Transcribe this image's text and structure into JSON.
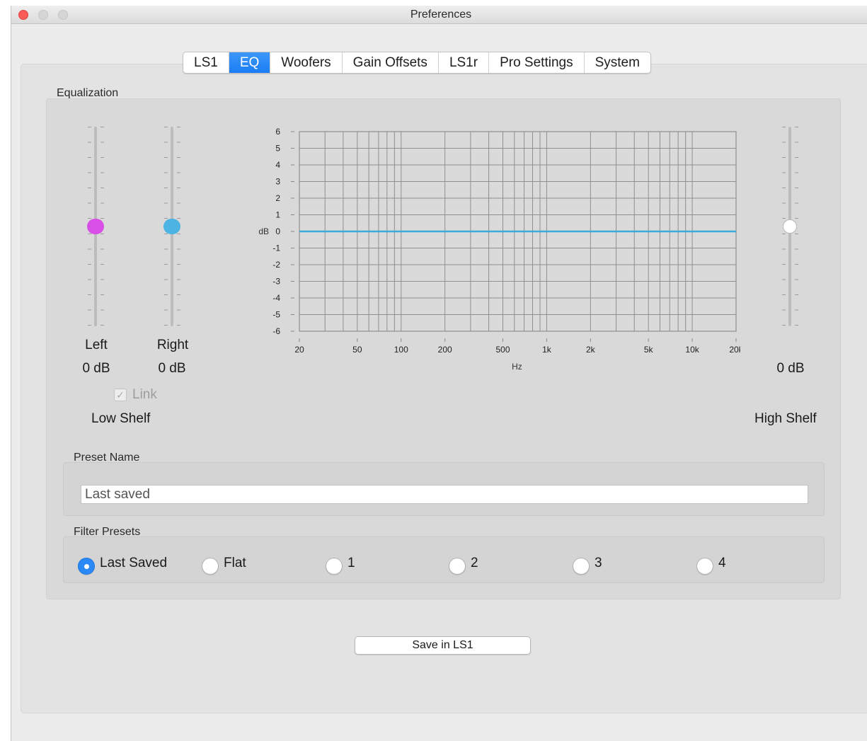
{
  "window": {
    "title": "Preferences"
  },
  "tabs": [
    {
      "label": "LS1",
      "active": false
    },
    {
      "label": "EQ",
      "active": true
    },
    {
      "label": "Woofers",
      "active": false
    },
    {
      "label": "Gain Offsets",
      "active": false
    },
    {
      "label": "LS1r",
      "active": false
    },
    {
      "label": "Pro Settings",
      "active": false
    },
    {
      "label": "System",
      "active": false
    }
  ],
  "equalization": {
    "group_label": "Equalization",
    "low_shelf": {
      "label": "Low Shelf",
      "left": {
        "label": "Left",
        "value": "0 dB",
        "level_db": 0,
        "knob_color": "#d84fe6"
      },
      "right": {
        "label": "Right",
        "value": "0 dB",
        "level_db": 0,
        "knob_color": "#4db3e3"
      },
      "link": {
        "label": "Link",
        "checked": true,
        "enabled": false
      }
    },
    "high_shelf": {
      "label": "High Shelf",
      "value": "0 dB",
      "level_db": 0,
      "knob_color": "#ffffff"
    },
    "slider_range_db": [
      -6,
      6
    ]
  },
  "chart_data": {
    "type": "line",
    "xlabel": "Hz",
    "ylabel": "dB",
    "x_scale": "log",
    "xlim": [
      20,
      20000
    ],
    "ylim": [
      -6,
      6
    ],
    "x_ticks": [
      {
        "value": 20,
        "label": "20"
      },
      {
        "value": 50,
        "label": "50"
      },
      {
        "value": 100,
        "label": "100"
      },
      {
        "value": 200,
        "label": "200"
      },
      {
        "value": 500,
        "label": "500"
      },
      {
        "value": 1000,
        "label": "1k"
      },
      {
        "value": 2000,
        "label": "2k"
      },
      {
        "value": 5000,
        "label": "5k"
      },
      {
        "value": 10000,
        "label": "10k"
      },
      {
        "value": 20000,
        "label": "20k"
      }
    ],
    "y_ticks": [
      6,
      5,
      4,
      3,
      2,
      1,
      0,
      -1,
      -2,
      -3,
      -4,
      -5,
      -6
    ],
    "grid": true,
    "series": [
      {
        "x": [
          20,
          20000
        ],
        "values": [
          0,
          0
        ],
        "color": "#3aa9dc"
      }
    ]
  },
  "preset_name": {
    "label": "Preset Name",
    "value": "Last saved"
  },
  "filter_presets": {
    "label": "Filter Presets",
    "options": [
      {
        "label": "Last Saved",
        "selected": true
      },
      {
        "label": "Flat",
        "selected": false
      },
      {
        "label": "1",
        "selected": false
      },
      {
        "label": "2",
        "selected": false
      },
      {
        "label": "3",
        "selected": false
      },
      {
        "label": "4",
        "selected": false
      }
    ]
  },
  "save_button": {
    "label": "Save in LS1"
  }
}
